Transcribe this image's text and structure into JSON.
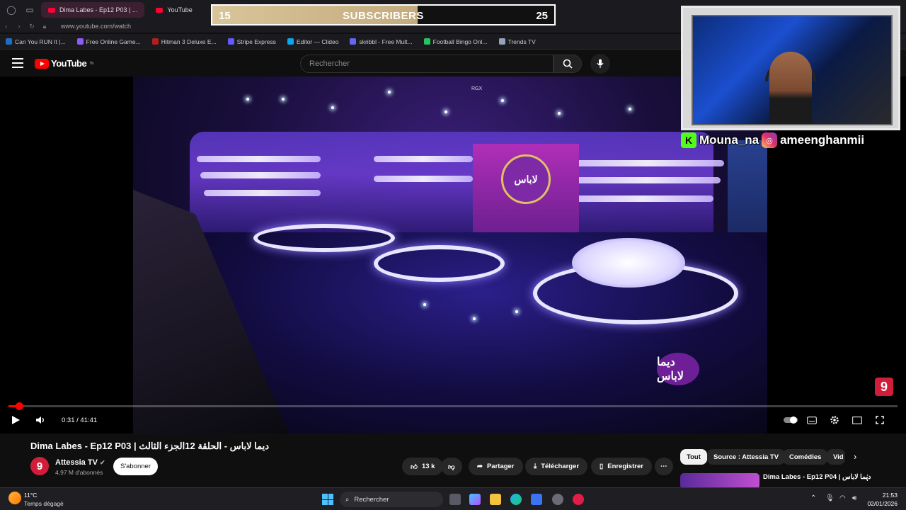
{
  "browser": {
    "tabs": [
      {
        "label": "Dima Labes - Ep12 P03 | ...",
        "active": true
      },
      {
        "label": "YouTube",
        "active": false
      }
    ],
    "url": "www.youtube.com/watch",
    "bookmarks": [
      {
        "label": "Can You RUN It |...",
        "color": "#1e6ec8"
      },
      {
        "label": "Free Online Game...",
        "color": "#8b5cf6"
      },
      {
        "label": "Hitman 3 Deluxe E...",
        "color": "#b91c1c"
      },
      {
        "label": "Stripe Express",
        "color": "#635bff"
      },
      {
        "label": "Editor — Clideo",
        "color": "#0ea5e9"
      },
      {
        "label": "skribbl - Free Mult...",
        "color": "#6366f1"
      },
      {
        "label": "Football Bingo Onl...",
        "color": "#22c55e"
      },
      {
        "label": "Trends TV",
        "color": "#94a3b8"
      }
    ]
  },
  "youtube": {
    "logo_text": "YouTube",
    "logo_sup": "TN",
    "search_placeholder": "Rechercher"
  },
  "overlay": {
    "sub_current": "15",
    "sub_label": "SUBSCRIBERS",
    "sub_target": "25",
    "sub_progress": 0.6,
    "kick_handle": "Mouna_na",
    "insta_handle": "ameenghanmii"
  },
  "player": {
    "time": "0:31 / 41:41",
    "progress": 0.012,
    "show_logo_text": "ديما لاباس",
    "center_logo_text": "لاباس",
    "channel_badge": "9",
    "hud_label": "RGX"
  },
  "video": {
    "title": "Dima Labes - Ep12 P03 | ديما لاباس - الحلقة 12الجزء الثالث",
    "channel_name": "Attessia TV",
    "channel_initial": "9",
    "subscribers": "4,97 M d'abonnés",
    "subscribe_label": "S'abonner",
    "likes": "13 k",
    "share_label": "Partager",
    "download_label": "Télécharger",
    "save_label": "Enregistrer"
  },
  "chips": [
    "Tout",
    "Source : Attessia TV",
    "Comédies",
    "Vid"
  ],
  "recommended": {
    "title": "Dima Labes - Ep12 P04 | ديما لاباس"
  },
  "taskbar": {
    "temperature": "11°C",
    "condition": "Temps dégagé",
    "search_label": "Rechercher",
    "time": "21:53",
    "date": "02/01/2026"
  }
}
